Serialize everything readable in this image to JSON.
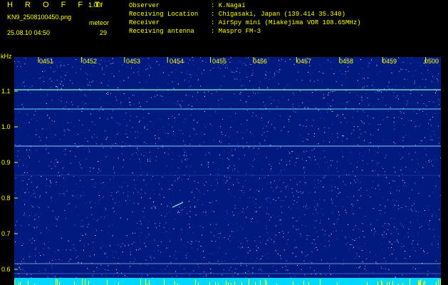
{
  "header": {
    "title": "H R O F F T",
    "version": "1.00f",
    "filename": "KN9_2508100450.png",
    "meteor_label": "meteor",
    "timestamp": "25.08.10 04:50",
    "meteor_count": "29"
  },
  "meta": [
    {
      "label": "Observer",
      "value": ": K.Nagai"
    },
    {
      "label": "Receiving Location",
      "value": ": Chigasaki, Japan (139.414 35.340)"
    },
    {
      "label": "Receiver",
      "value": ": AirSpy mini (Miakejima VOR 108.65MHz)"
    },
    {
      "label": "Receiving antenna",
      "value": ": Maspro FM-3"
    }
  ],
  "plot": {
    "y_unit": "kHz",
    "y_ticks": [
      "1.1",
      "1.0",
      "0.9",
      "0.8",
      "0.7",
      "0.6"
    ],
    "x_ticks": [
      "0451",
      "0452",
      "0453",
      "0454",
      "0455",
      "0456",
      "0457",
      "0458",
      "0459",
      "0500"
    ],
    "colors": {
      "background": "#001a80",
      "text": "#ffff00",
      "bar": "#00d8ff"
    }
  }
}
